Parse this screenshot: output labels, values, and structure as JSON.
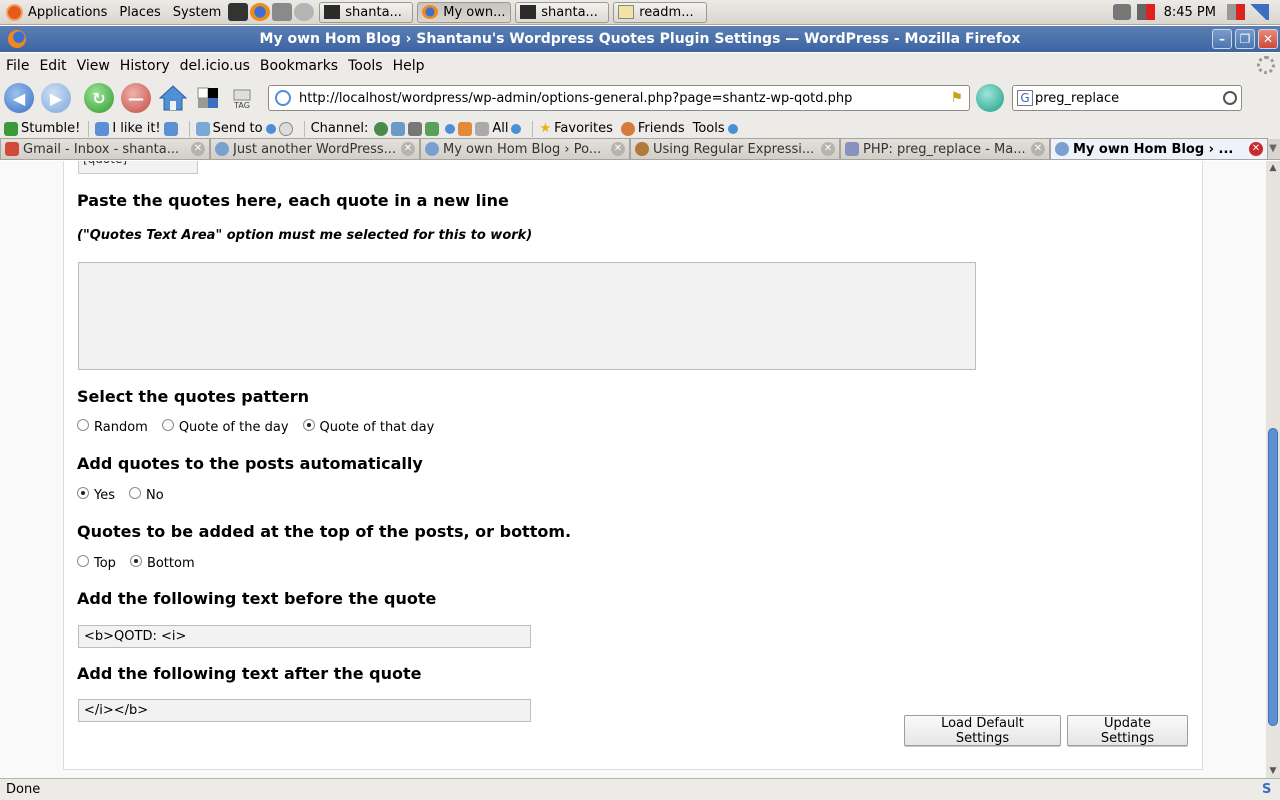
{
  "gnome_panel": {
    "menus": [
      "Applications",
      "Places",
      "System"
    ],
    "tasks": [
      {
        "label": "shanta...",
        "icon": "terminal-icon"
      },
      {
        "label": "My own...",
        "icon": "firefox-icon",
        "active": true
      },
      {
        "label": "shanta...",
        "icon": "terminal-icon"
      },
      {
        "label": "readm...",
        "icon": "text-editor-icon"
      }
    ],
    "clock": "8:45 PM"
  },
  "window": {
    "title": "My own Hom Blog › Shantanu's Wordpress Quotes Plugin Settings — WordPress - Mozilla Firefox"
  },
  "menubar": [
    "File",
    "Edit",
    "View",
    "History",
    "del.icio.us",
    "Bookmarks",
    "Tools",
    "Help"
  ],
  "navbar": {
    "url": "http://localhost/wordpress/wp-admin/options-general.php?page=shantz-wp-qotd.php",
    "search_value": "preg_replace",
    "search_engine": "G"
  },
  "stumblebar": {
    "stumble": "Stumble!",
    "like": "I like it!",
    "send": "Send to",
    "channel": "Channel:",
    "all": "All",
    "favorites": "Favorites",
    "friends": "Friends",
    "tools": "Tools"
  },
  "tabs": [
    {
      "label": "Gmail - Inbox - shanta..."
    },
    {
      "label": "Just another WordPress..."
    },
    {
      "label": "My own Hom Blog › Po..."
    },
    {
      "label": "Using Regular Expressi..."
    },
    {
      "label": "PHP: preg_replace - Ma..."
    },
    {
      "label": "My own Hom Blog › ...",
      "active": true
    }
  ],
  "form": {
    "shortcode_stub": "[quote]",
    "paste_heading": "Paste the quotes here, each quote in a new line",
    "paste_note": "(\"Quotes Text Area\" option must me selected for this to work)",
    "quotes_text": "",
    "pattern_heading": "Select the quotes pattern",
    "pattern_options": [
      "Random",
      "Quote of the day",
      "Quote of that day"
    ],
    "pattern_selected": 2,
    "auto_heading": "Add quotes to the posts automatically",
    "auto_options": [
      "Yes",
      "No"
    ],
    "auto_selected": 0,
    "position_heading": "Quotes to be added at the top of the posts, or bottom.",
    "position_options": [
      "Top",
      "Bottom"
    ],
    "position_selected": 1,
    "before_heading": "Add the following text before the quote",
    "before_value": "<b>QOTD: <i>",
    "after_heading": "Add the following text after the quote",
    "after_value": "</i></b>",
    "load_defaults_label": "Load Default Settings",
    "update_label": "Update Settings"
  },
  "status": "Done"
}
